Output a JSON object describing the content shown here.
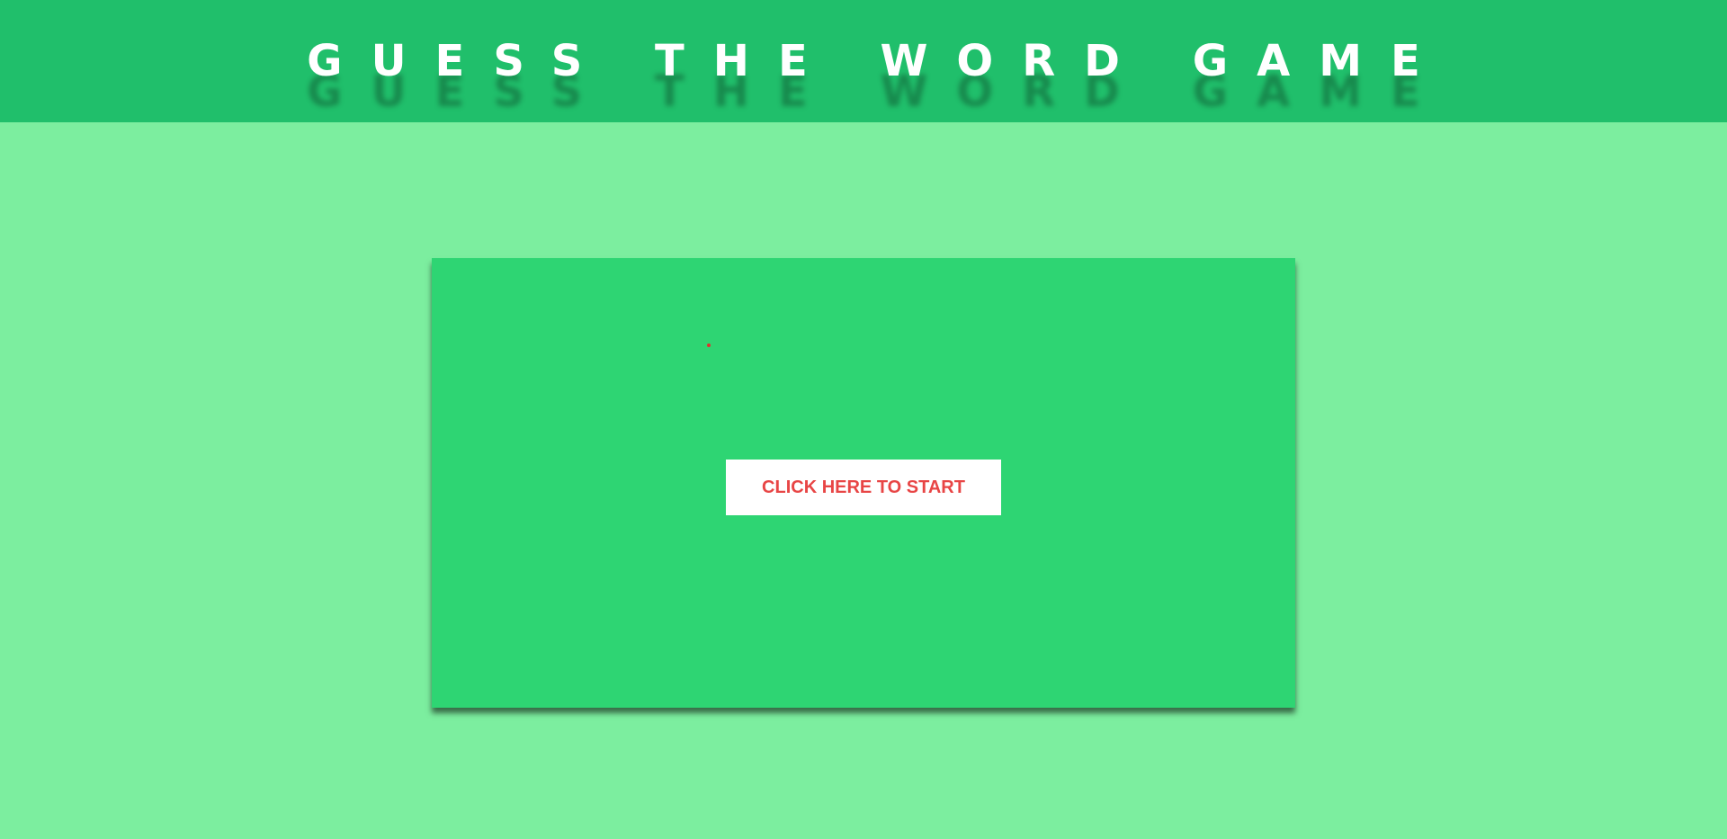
{
  "header": {
    "title": "GUESS THE WORD GAME"
  },
  "game": {
    "start_button_label": "CLICK HERE TO START",
    "message_text": "."
  },
  "colors": {
    "header_bg": "#20bf6b",
    "page_bg": "#7cee9f",
    "panel_bg": "#2ed573",
    "button_bg": "#ffffff",
    "button_text": "#e84545"
  }
}
